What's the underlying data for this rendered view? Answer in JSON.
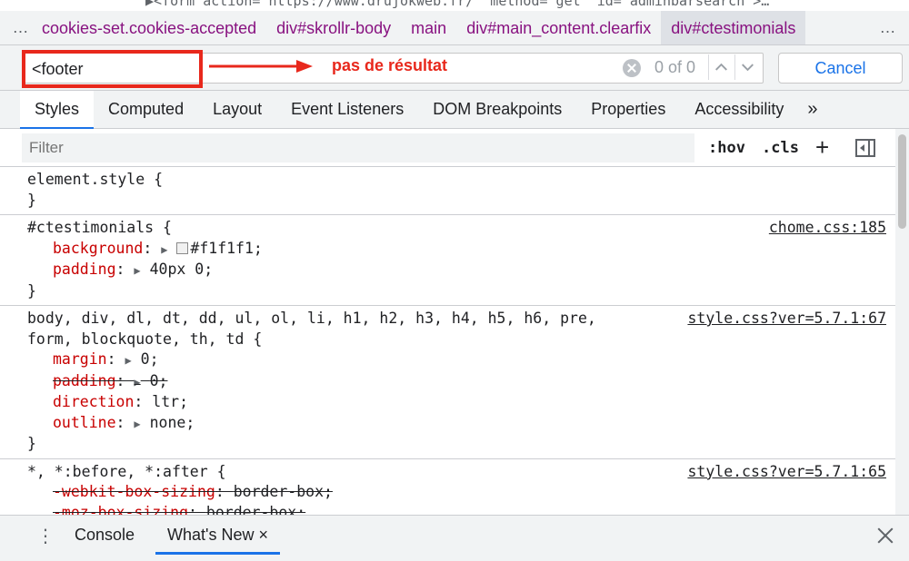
{
  "code_peek": "▶<form action=\"https://www.drujokweb.fr/\" method=\"get\" id=\"adminbarsearch\">…",
  "breadcrumb": {
    "more_left": "…",
    "items": [
      "cookies-set.cookies-accepted",
      "div#skrollr-body",
      "main",
      "div#main_content.clearfix",
      "div#ctestimonials"
    ],
    "more_right": "…"
  },
  "search": {
    "value": "<footer",
    "match_count": "0 of 0",
    "cancel_label": "Cancel",
    "annotation": "pas de résultat"
  },
  "tabs": {
    "items": [
      "Styles",
      "Computed",
      "Layout",
      "Event Listeners",
      "DOM Breakpoints",
      "Properties",
      "Accessibility"
    ],
    "more": "»"
  },
  "filter": {
    "placeholder": "Filter",
    "hov_label": ":hov",
    "cls_label": ".cls",
    "add_label": "+"
  },
  "rules": [
    {
      "selector": "element.style {",
      "source": "",
      "declarations": [],
      "close": "}"
    },
    {
      "selector": "#ctestimonials {",
      "source": "chome.css:185",
      "declarations": [
        {
          "name": "background",
          "value": "#f1f1f1;",
          "swatch": "#f1f1f1",
          "struck": false
        },
        {
          "name": "padding",
          "value": "40px 0;",
          "struck": false
        }
      ],
      "close": "}"
    },
    {
      "selector": "body, div, dl, dt, dd, ul, ol, li, h1, h2, h3, h4, h5, h6, pre,\nform, blockquote, th, td {",
      "source": "style.css?ver=5.7.1:67",
      "declarations": [
        {
          "name": "margin",
          "value": "0;",
          "struck": false
        },
        {
          "name": "padding",
          "value": "0;",
          "struck": true
        },
        {
          "name": "direction",
          "value": "ltr;",
          "struck": false
        },
        {
          "name": "outline",
          "value": "none;",
          "struck": false
        }
      ],
      "close": "}"
    },
    {
      "selector": "*, *:before, *:after {",
      "source": "style.css?ver=5.7.1:65",
      "declarations": [
        {
          "name": "-webkit-box-sizing",
          "value": "border-box;",
          "struck": true
        },
        {
          "name": "-moz-box-sizing",
          "value": "border-box;",
          "struck": true
        }
      ],
      "close": "}"
    }
  ],
  "drawer": {
    "menu_icon": "⋮",
    "console_label": "Console",
    "whats_new_label": "What's New",
    "tab_close": "×"
  },
  "colors": {
    "accent": "#1a73e8",
    "annotation_red": "#e8281c",
    "property_red": "#c80000",
    "breadcrumb_purple": "#881280"
  }
}
